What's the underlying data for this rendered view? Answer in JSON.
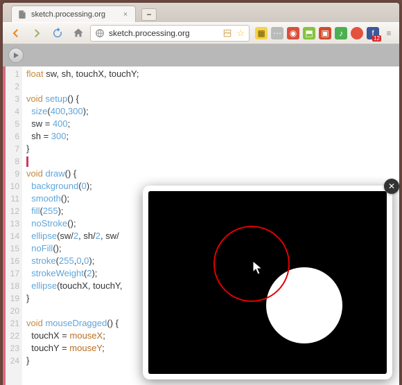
{
  "browser": {
    "tab_title": "sketch.processing.org",
    "url": "sketch.processing.org",
    "star_glyph": "☆",
    "extensions": [
      {
        "name": "ext-1",
        "cls": "ylw",
        "glyph": "▦"
      },
      {
        "name": "ext-2",
        "cls": "gry",
        "glyph": "⋯"
      },
      {
        "name": "ext-3",
        "cls": "red",
        "glyph": "◉"
      },
      {
        "name": "ext-4",
        "cls": "grn",
        "glyph": "⬒"
      },
      {
        "name": "ext-5",
        "cls": "rd2",
        "glyph": "▣"
      },
      {
        "name": "ext-6",
        "cls": "grn2",
        "glyph": "♪"
      },
      {
        "name": "ext-7",
        "cls": "tom",
        "glyph": ""
      },
      {
        "name": "facebook",
        "cls": "fb",
        "glyph": "f",
        "badge": "12"
      },
      {
        "name": "menu",
        "cls": "menu",
        "glyph": "≡"
      }
    ]
  },
  "code": {
    "lines": [
      [
        {
          "t": "float ",
          "c": "k-type"
        },
        {
          "t": "sw, sh, touchX, touchY;"
        }
      ],
      [
        {
          "t": ""
        }
      ],
      [
        {
          "t": "void ",
          "c": "k-void"
        },
        {
          "t": "setup",
          "c": "k-fn"
        },
        {
          "t": "() {"
        }
      ],
      [
        {
          "t": "  "
        },
        {
          "t": "size",
          "c": "k-fn"
        },
        {
          "t": "("
        },
        {
          "t": "400",
          "c": "k-num"
        },
        {
          "t": ","
        },
        {
          "t": "300",
          "c": "k-num"
        },
        {
          "t": ");"
        }
      ],
      [
        {
          "t": "  sw = "
        },
        {
          "t": "400",
          "c": "k-num"
        },
        {
          "t": ";"
        }
      ],
      [
        {
          "t": "  sh = "
        },
        {
          "t": "300",
          "c": "k-num"
        },
        {
          "t": ";"
        }
      ],
      [
        {
          "t": "}"
        }
      ],
      [
        {
          "t": "",
          "caret": true
        }
      ],
      [
        {
          "t": "void ",
          "c": "k-void"
        },
        {
          "t": "draw",
          "c": "k-fn"
        },
        {
          "t": "() {"
        }
      ],
      [
        {
          "t": "  "
        },
        {
          "t": "background",
          "c": "k-fn"
        },
        {
          "t": "("
        },
        {
          "t": "0",
          "c": "k-num"
        },
        {
          "t": ");"
        }
      ],
      [
        {
          "t": "  "
        },
        {
          "t": "smooth",
          "c": "k-fn"
        },
        {
          "t": "();"
        }
      ],
      [
        {
          "t": "  "
        },
        {
          "t": "fill",
          "c": "k-fn"
        },
        {
          "t": "("
        },
        {
          "t": "255",
          "c": "k-num"
        },
        {
          "t": ");"
        }
      ],
      [
        {
          "t": "  "
        },
        {
          "t": "noStroke",
          "c": "k-fn"
        },
        {
          "t": "();"
        }
      ],
      [
        {
          "t": "  "
        },
        {
          "t": "ellipse",
          "c": "k-fn"
        },
        {
          "t": "(sw/"
        },
        {
          "t": "2",
          "c": "k-num"
        },
        {
          "t": ", sh/"
        },
        {
          "t": "2",
          "c": "k-num"
        },
        {
          "t": ", sw/"
        }
      ],
      [
        {
          "t": "  "
        },
        {
          "t": "noFill",
          "c": "k-fn"
        },
        {
          "t": "();"
        }
      ],
      [
        {
          "t": "  "
        },
        {
          "t": "stroke",
          "c": "k-fn"
        },
        {
          "t": "("
        },
        {
          "t": "255",
          "c": "k-num"
        },
        {
          "t": ","
        },
        {
          "t": "0",
          "c": "k-num"
        },
        {
          "t": ","
        },
        {
          "t": "0",
          "c": "k-num"
        },
        {
          "t": ");"
        }
      ],
      [
        {
          "t": "  "
        },
        {
          "t": "strokeWeight",
          "c": "k-fn"
        },
        {
          "t": "("
        },
        {
          "t": "2",
          "c": "k-num"
        },
        {
          "t": ");"
        }
      ],
      [
        {
          "t": "  "
        },
        {
          "t": "ellipse",
          "c": "k-fn"
        },
        {
          "t": "(touchX, touchY,"
        }
      ],
      [
        {
          "t": "}"
        }
      ],
      [
        {
          "t": ""
        }
      ],
      [
        {
          "t": "void ",
          "c": "k-void"
        },
        {
          "t": "mouseDragged",
          "c": "k-fn"
        },
        {
          "t": "() {"
        }
      ],
      [
        {
          "t": "  touchX = "
        },
        {
          "t": "mouseX",
          "c": "k-id"
        },
        {
          "t": ";"
        }
      ],
      [
        {
          "t": "  touchY = "
        },
        {
          "t": "mouseY",
          "c": "k-id"
        },
        {
          "t": ";"
        }
      ],
      [
        {
          "t": "}"
        }
      ]
    ]
  },
  "output": {
    "close_glyph": "✕"
  }
}
